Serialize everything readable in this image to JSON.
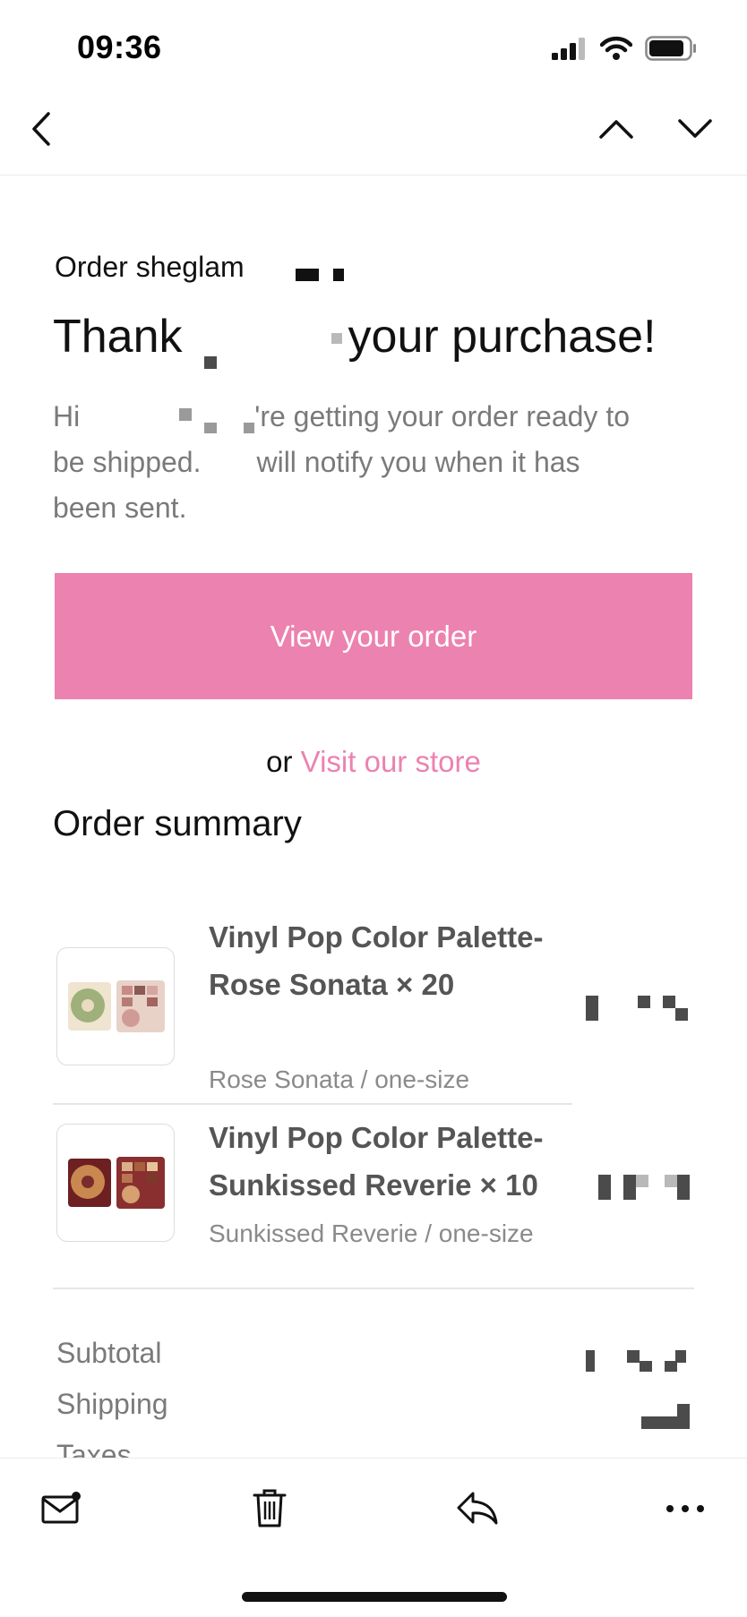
{
  "status_bar": {
    "time": "09:36",
    "icons": [
      "cellular-signal-icon",
      "wifi-icon",
      "battery-icon"
    ]
  },
  "nav": {
    "icons": [
      "back-chevron-icon",
      "previous-message-icon",
      "next-message-icon"
    ]
  },
  "email": {
    "order_label": "Order sheglam",
    "headline_start": "Thank",
    "headline_end": "your purchase!",
    "intro_line1_start": "Hi",
    "intro_line1_end": "'re getting your order ready to",
    "intro_line2_start": "be shipped.",
    "intro_line2_end": "will notify you when it has",
    "intro_line3": "been sent.",
    "cta_label": "View your order",
    "or_text": "or",
    "store_link": "Visit our store",
    "summary_title": "Order summary",
    "items": [
      {
        "title": "Vinyl Pop Color Palette-Rose Sonata × 20",
        "variant": "Rose Sonata / one-size"
      },
      {
        "title": "Vinyl Pop Color Palette-Sunkissed Reverie × 10",
        "variant": "Sunkissed Reverie / one-size"
      }
    ],
    "totals": {
      "subtotal_label": "Subtotal",
      "shipping_label": "Shipping",
      "taxes_label": "Taxes"
    }
  },
  "colors": {
    "accent_pink": "#EC82B0",
    "muted_text": "#7A7A7A",
    "item_text": "#555555"
  },
  "toolbar": {
    "icons": [
      "mail-icon",
      "trash-icon",
      "reply-icon",
      "more-icon"
    ]
  }
}
